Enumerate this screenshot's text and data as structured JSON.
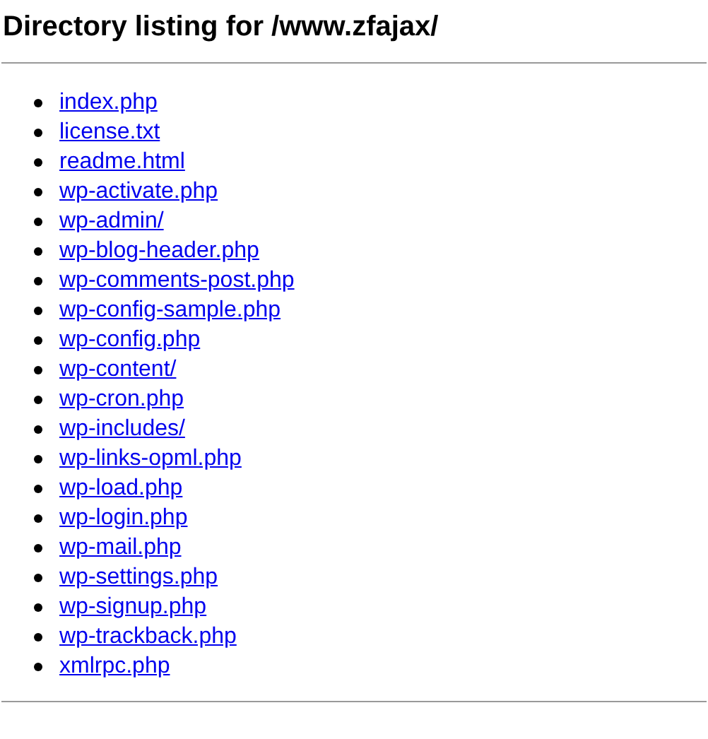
{
  "title": "Directory listing for /www.zfajax/",
  "entries": [
    "index.php",
    "license.txt",
    "readme.html",
    "wp-activate.php",
    "wp-admin/",
    "wp-blog-header.php",
    "wp-comments-post.php",
    "wp-config-sample.php",
    "wp-config.php",
    "wp-content/",
    "wp-cron.php",
    "wp-includes/",
    "wp-links-opml.php",
    "wp-load.php",
    "wp-login.php",
    "wp-mail.php",
    "wp-settings.php",
    "wp-signup.php",
    "wp-trackback.php",
    "xmlrpc.php"
  ]
}
